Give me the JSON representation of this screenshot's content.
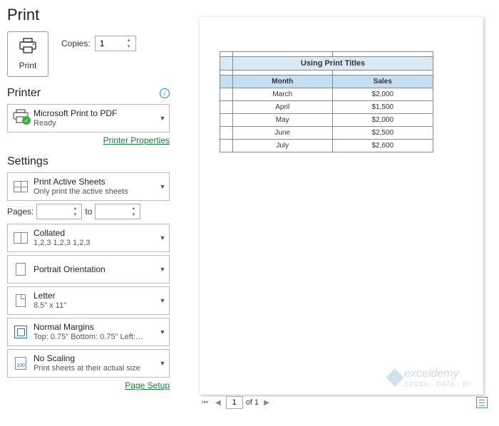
{
  "title": "Print",
  "print_button_label": "Print",
  "copies": {
    "label": "Copies:",
    "value": "1"
  },
  "printer_section": {
    "heading": "Printer",
    "selected": {
      "name": "Microsoft Print to PDF",
      "status": "Ready"
    },
    "properties_link": "Printer Properties"
  },
  "settings_section": {
    "heading": "Settings",
    "scope": {
      "main": "Print Active Sheets",
      "sub": "Only print the active sheets"
    },
    "pages": {
      "label": "Pages:",
      "from": "",
      "to_label": "to",
      "to": ""
    },
    "collate": {
      "main": "Collated",
      "sub": "1,2,3    1,2,3    1,2,3"
    },
    "orientation": {
      "main": "Portrait Orientation"
    },
    "paper": {
      "main": "Letter",
      "sub": "8.5\" x 11\""
    },
    "margins": {
      "main": "Normal Margins",
      "sub": "Top: 0.75\" Bottom: 0.75\" Left:…"
    },
    "scaling": {
      "main": "No Scaling",
      "sub": "Print sheets at their actual size",
      "icon_text": "100"
    },
    "page_setup_link": "Page Setup"
  },
  "preview": {
    "table_title": "Using Print Titles",
    "col1": "Month",
    "col2": "Sales",
    "rows": [
      {
        "month": "March",
        "sales": "$2,000"
      },
      {
        "month": "April",
        "sales": "$1,500"
      },
      {
        "month": "May",
        "sales": "$2,000"
      },
      {
        "month": "June",
        "sales": "$2,500"
      },
      {
        "month": "July",
        "sales": "$2,600"
      }
    ]
  },
  "watermark": {
    "brand": "exceldemy",
    "tagline": "EXCEL · DATA · BI"
  },
  "pagination": {
    "current": "1",
    "of_label": "of 1"
  },
  "chart_data": {
    "type": "table",
    "title": "Using Print Titles",
    "columns": [
      "Month",
      "Sales"
    ],
    "rows": [
      [
        "March",
        2000
      ],
      [
        "April",
        1500
      ],
      [
        "May",
        2000
      ],
      [
        "June",
        2500
      ],
      [
        "July",
        2600
      ]
    ]
  }
}
